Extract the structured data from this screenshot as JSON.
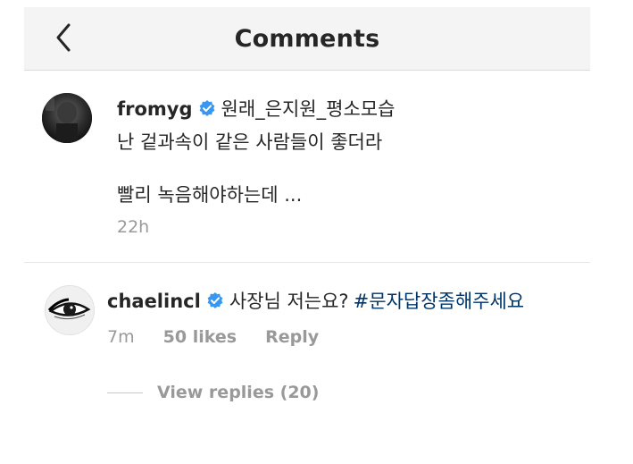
{
  "header": {
    "title": "Comments"
  },
  "comments": [
    {
      "username": "fromyg",
      "first_line": "원래_은지원_평소모습",
      "second_line": "난 겉과속이 같은 사람들이 좋더라",
      "third_line": "빨리 녹음해야하는데 ...",
      "time": "22h"
    },
    {
      "username": "chaelincl",
      "text": "사장님 저는요?",
      "hashtag": "#문자답장좀해주세요",
      "time": "7m",
      "likes": "50 likes",
      "reply": "Reply",
      "view_replies": "View replies (20)"
    }
  ],
  "colors": {
    "verified_badge": "#3897f0",
    "hashtag": "#003569",
    "meta_text": "#999999"
  },
  "icons": {
    "back": "chevron-left-icon",
    "verified": "verified-badge-icon"
  }
}
